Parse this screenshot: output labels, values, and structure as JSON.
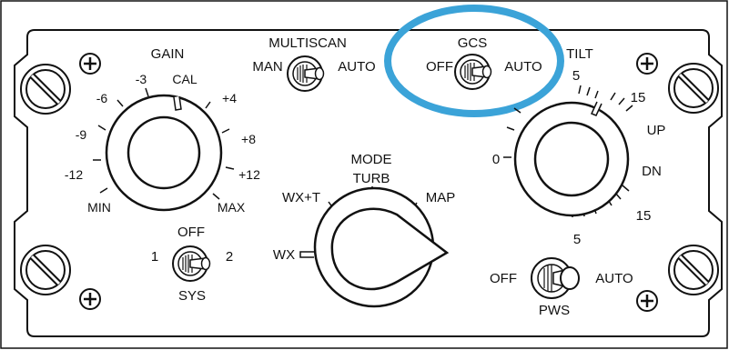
{
  "colors": {
    "outline": "#111111",
    "background": "#ffffff",
    "highlight": "#3ba3d8"
  },
  "icons": {
    "corner_screw": "slotted-screw-icon",
    "mount_screw": "phillips-screw-icon"
  },
  "gain": {
    "title": "GAIN",
    "marks": [
      "-3",
      "CAL",
      "-6",
      "+4",
      "-9",
      "+8",
      "-12",
      "+12",
      "MIN",
      "MAX"
    ]
  },
  "multiscan": {
    "title": "MULTISCAN",
    "left": "MAN",
    "right": "AUTO"
  },
  "gcs": {
    "title": "GCS",
    "left": "OFF",
    "right": "AUTO",
    "highlighted": true
  },
  "tilt": {
    "title": "TILT",
    "marks": [
      "5",
      "15",
      "UP",
      "0",
      "DN",
      "15",
      "5"
    ]
  },
  "mode": {
    "title": "MODE",
    "marks": [
      "TURB",
      "WX+T",
      "MAP",
      "WX"
    ]
  },
  "sys": {
    "top": "OFF",
    "left": "1",
    "right": "2",
    "bottom": "SYS"
  },
  "pws": {
    "left": "OFF",
    "right": "AUTO",
    "bottom": "PWS"
  }
}
